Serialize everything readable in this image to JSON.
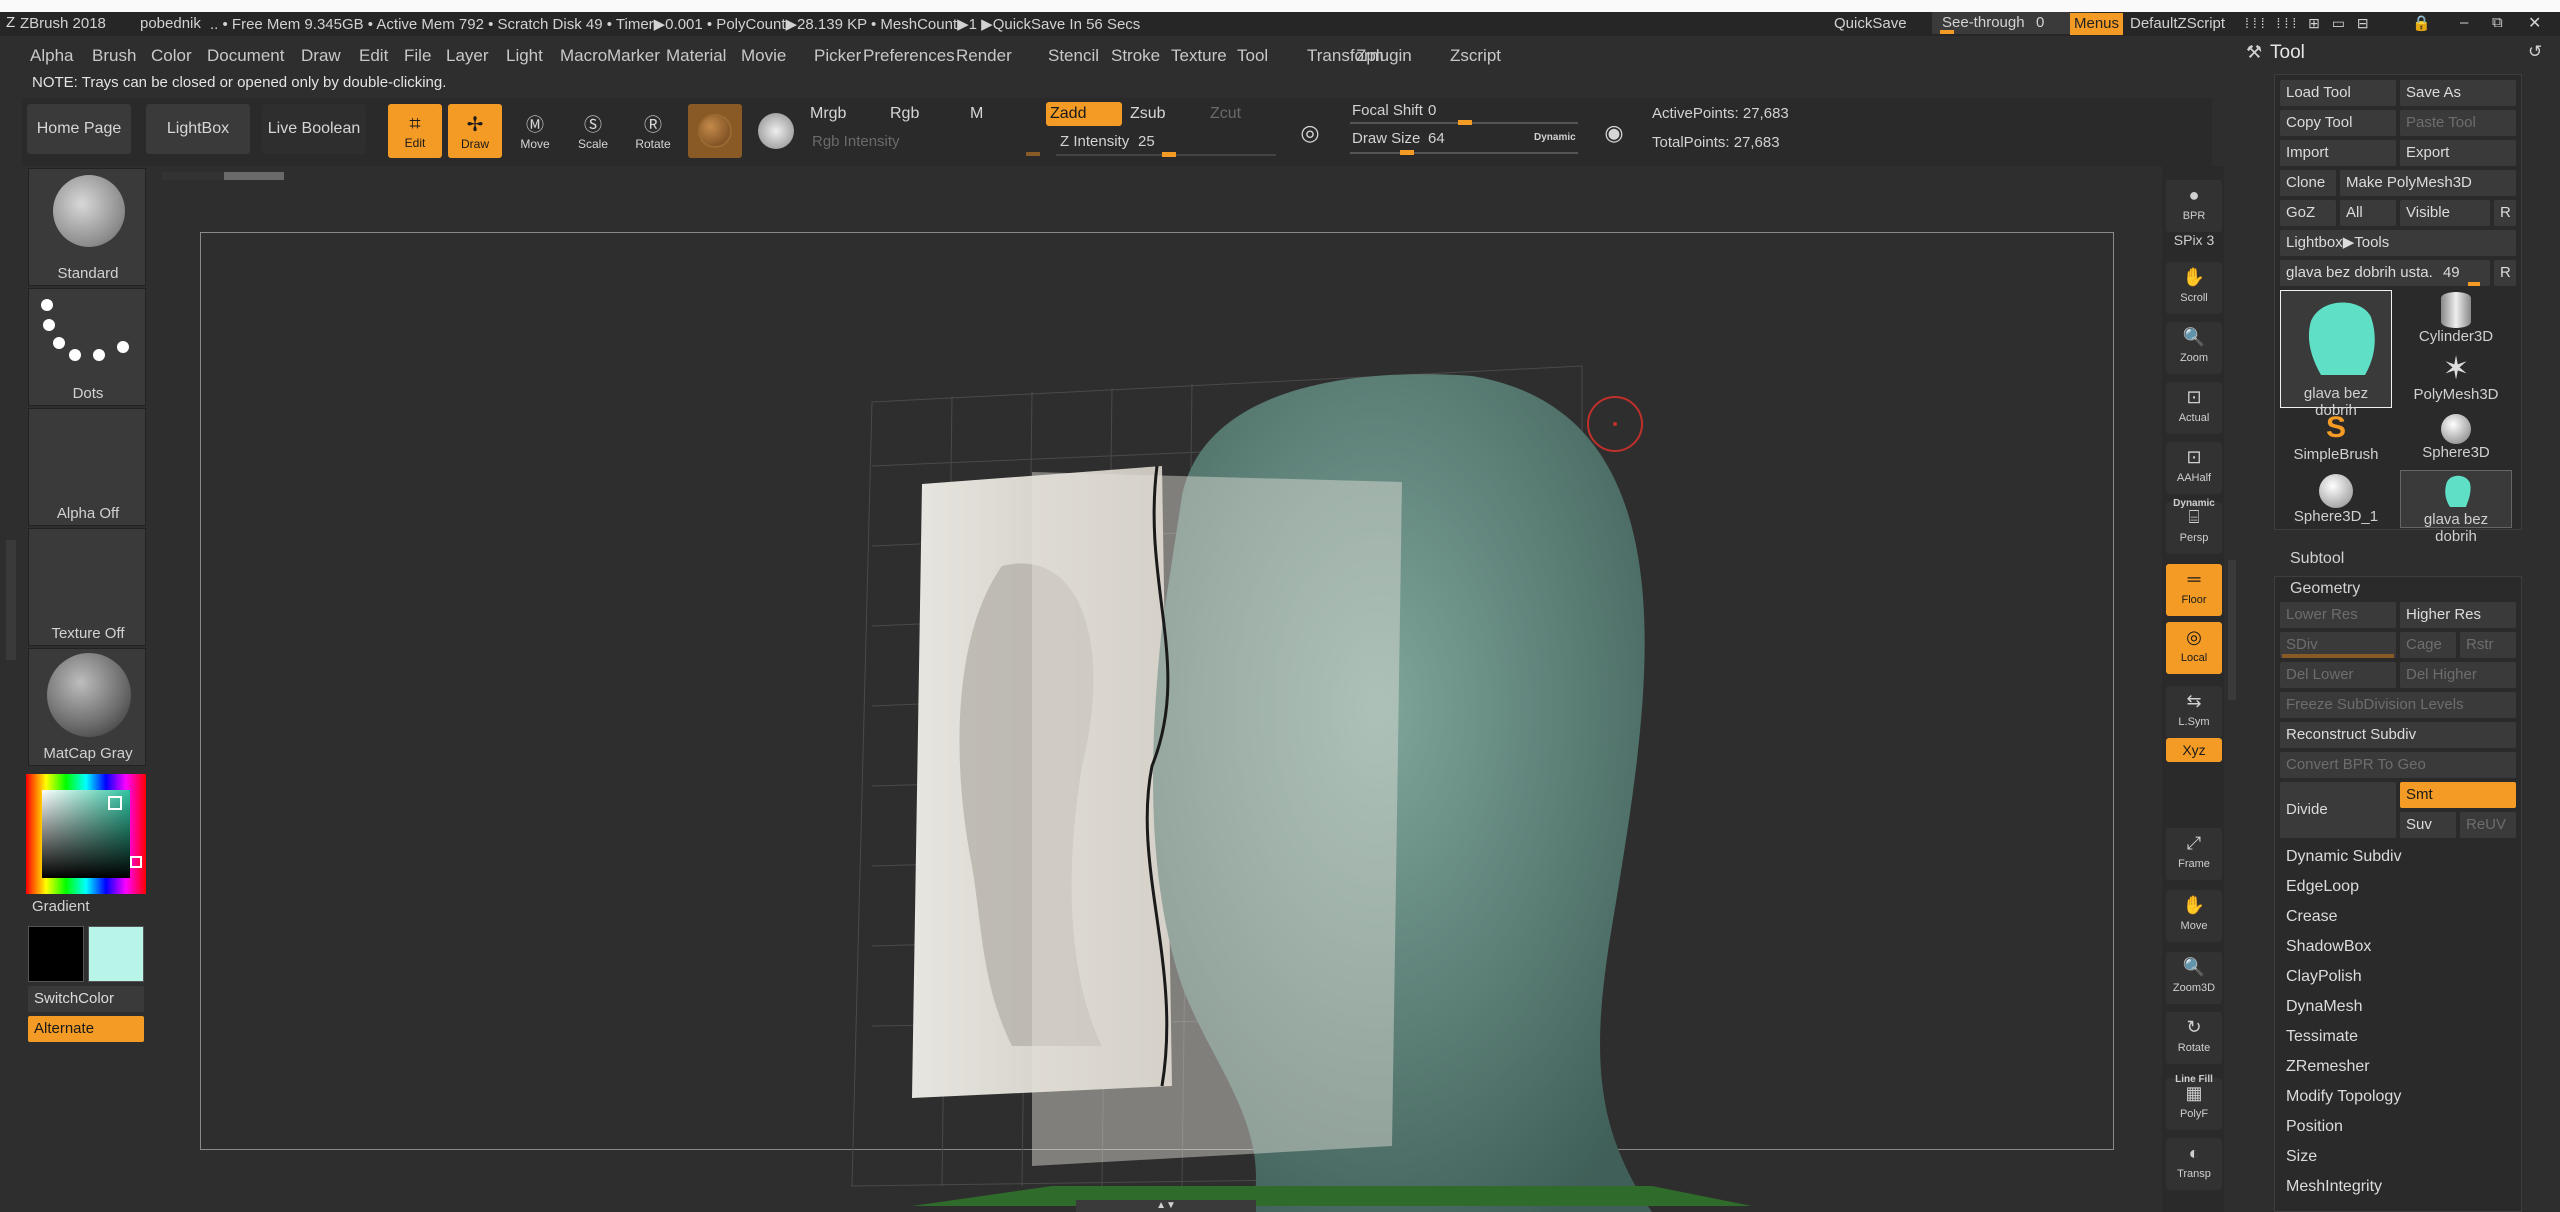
{
  "titlebar": {
    "app": "ZBrush 2018",
    "document": "pobednik",
    "status": ".. • Free Mem 9.345GB • Active Mem 792 • Scratch Disk 49 •  Timer▶0.001 • PolyCount▶28.139 KP  • MeshCount▶1  ▶QuickSave In 56 Secs",
    "quicksave": "QuickSave",
    "seethrough_label": "See-through",
    "seethrough_value": "0",
    "menus": "Menus",
    "zscript": "DefaultZScript"
  },
  "menubar": [
    "Alpha",
    "Brush",
    "Color",
    "Document",
    "Draw",
    "Edit",
    "File",
    "Layer",
    "Light",
    "Macro",
    "Marker",
    "Material",
    "Movie",
    "Picker",
    "Preferences",
    "Render",
    "Stencil",
    "Stroke",
    "Texture",
    "Tool",
    "Transform",
    "Zplugin",
    "Zscript"
  ],
  "note": "NOTE: Trays can be closed or opened only by double-clicking.",
  "toolbar": {
    "home": "Home Page",
    "lightbox": "LightBox",
    "live_boolean": "Live Boolean",
    "edit": "Edit",
    "draw": "Draw",
    "move": "Move",
    "scale": "Scale",
    "rotate": "Rotate",
    "mrgb": "Mrgb",
    "rgb": "Rgb",
    "m": "M",
    "zadd": "Zadd",
    "zsub": "Zsub",
    "zcut": "Zcut",
    "rgb_intensity": "Rgb Intensity",
    "z_intensity_label": "Z Intensity",
    "z_intensity_value": "25",
    "focal_shift_label": "Focal Shift",
    "focal_shift_value": "0",
    "draw_size_label": "Draw Size",
    "draw_size_value": "64",
    "dynamic": "Dynamic",
    "active_points": "ActivePoints: 27,683",
    "total_points": "TotalPoints: 27,683"
  },
  "left_shelf": {
    "brush": "Standard",
    "stroke": "Dots",
    "alpha": "Alpha Off",
    "texture": "Texture Off",
    "material": "MatCap Gray",
    "gradient": "Gradient",
    "switchcolor": "SwitchColor",
    "alternate": "Alternate"
  },
  "right_shelf": [
    "BPR",
    "SPix 3",
    "Scroll",
    "Zoom",
    "Actual",
    "AAHalf",
    "Persp",
    "Floor",
    "Local",
    "L.Sym",
    "Xyz",
    "Frame",
    "Move",
    "Zoom3D",
    "Rotate",
    "PolyF",
    "Transp"
  ],
  "right_shelf_top": [
    "Dynamic",
    "Line Fill"
  ],
  "tool_panel": {
    "title": "Tool",
    "load_tool": "Load Tool",
    "save_as": "Save As",
    "copy_tool": "Copy Tool",
    "paste_tool": "Paste Tool",
    "import": "Import",
    "export": "Export",
    "clone": "Clone",
    "make_polymesh": "Make PolyMesh3D",
    "goz": "GoZ",
    "all": "All",
    "visible": "Visible",
    "r": "R",
    "lightbox_tools": "Lightbox▶Tools",
    "current_tool_label": "glava bez dobrih usta.",
    "current_tool_value": "49",
    "thumbs": [
      "glava bez dobrih",
      "Cylinder3D",
      "PolyMesh3D",
      "SimpleBrush",
      "Sphere3D",
      "Sphere3D_1",
      "glava bez dobrih"
    ],
    "subtool": "Subtool",
    "geometry": "Geometry",
    "lower_res": "Lower Res",
    "higher_res": "Higher Res",
    "sdiv": "SDiv",
    "cage": "Cage",
    "rstr": "Rstr",
    "del_lower": "Del Lower",
    "del_higher": "Del Higher",
    "freeze": "Freeze SubDivision Levels",
    "reconstruct": "Reconstruct Subdiv",
    "convert_bpr": "Convert BPR To Geo",
    "divide": "Divide",
    "smt": "Smt",
    "suv": "Suv",
    "reuv": "ReUV",
    "sections": [
      "Dynamic Subdiv",
      "EdgeLoop",
      "Crease",
      "ShadowBox",
      "ClayPolish",
      "DynaMesh",
      "Tessimate",
      "ZRemesher",
      "Modify Topology",
      "Position",
      "Size",
      "MeshIntegrity"
    ]
  },
  "colors": {
    "accent": "#f39b25",
    "bg": "#2e2e2e",
    "panel": "#3a3a3a",
    "secondary_color": "#b9f4e8",
    "mesh": "#5f8a80"
  }
}
